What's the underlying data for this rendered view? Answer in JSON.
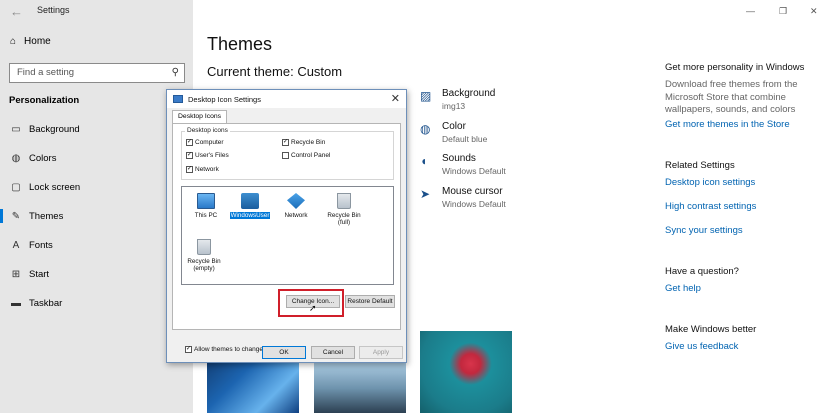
{
  "sidebar": {
    "back_glyph": "←",
    "app_title": "Settings",
    "home_label": "Home",
    "search_placeholder": "Find a setting",
    "section_title": "Personalization",
    "items": [
      {
        "label": "Background",
        "icon": "picture-icon"
      },
      {
        "label": "Colors",
        "icon": "palette-icon"
      },
      {
        "label": "Lock screen",
        "icon": "lock-screen-icon"
      },
      {
        "label": "Themes",
        "icon": "themes-icon",
        "active": true
      },
      {
        "label": "Fonts",
        "icon": "fonts-icon"
      },
      {
        "label": "Start",
        "icon": "start-icon"
      },
      {
        "label": "Taskbar",
        "icon": "taskbar-icon"
      }
    ]
  },
  "window_controls": {
    "minimize": "—",
    "maximize": "❐",
    "close": "✕"
  },
  "main": {
    "title": "Themes",
    "current_theme": "Current theme: Custom",
    "properties": [
      {
        "name": "Background",
        "value": "img13",
        "icon": "picture-icon"
      },
      {
        "name": "Color",
        "value": "Default blue",
        "icon": "palette-icon"
      },
      {
        "name": "Sounds",
        "value": "Windows Default",
        "icon": "speaker-icon"
      },
      {
        "name": "Mouse cursor",
        "value": "Windows Default",
        "icon": "cursor-icon"
      }
    ]
  },
  "right": {
    "personality_title": "Get more personality in Windows",
    "personality_text": "Download free themes from the Microsoft Store that combine wallpapers, sounds, and colors",
    "personality_link": "Get more themes in the Store",
    "related_title": "Related Settings",
    "related_links": [
      "Desktop icon settings",
      "High contrast settings",
      "Sync your settings"
    ],
    "question_title": "Have a question?",
    "question_link": "Get help",
    "better_title": "Make Windows better",
    "better_link": "Give us feedback"
  },
  "dialog": {
    "title": "Desktop Icon Settings",
    "close_glyph": "✕",
    "tab": "Desktop Icons",
    "group_title": "Desktop icons",
    "checkboxes": [
      {
        "label": "Computer",
        "checked": true
      },
      {
        "label": "Recycle Bin",
        "checked": true
      },
      {
        "label": "User's Files",
        "checked": true
      },
      {
        "label": "Control Panel",
        "checked": false
      },
      {
        "label": "Network",
        "checked": true
      }
    ],
    "icons": [
      {
        "label": "This PC"
      },
      {
        "label": "WindowsUser",
        "selected": true
      },
      {
        "label": "Network"
      },
      {
        "label": "Recycle Bin (full)"
      },
      {
        "label": "Recycle Bin (empty)"
      }
    ],
    "change_icon_button": "Change Icon...",
    "restore_default_button": "Restore Default",
    "allow_themes_label": "Allow themes to change desktop icons",
    "allow_themes_checked": true,
    "ok_button": "OK",
    "cancel_button": "Cancel",
    "apply_button": "Apply"
  },
  "checkmark": "✓"
}
